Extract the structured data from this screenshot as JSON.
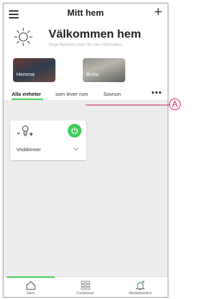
{
  "header": {
    "title": "Mitt hem",
    "welcome": "Välkommen hem",
    "subtitle": "Ange hemmets plats för mer information."
  },
  "modes": [
    {
      "label": "Hemma"
    },
    {
      "label": "Borta"
    }
  ],
  "tabs": [
    {
      "label": "Alla enheter"
    },
    {
      "label": "som lever rum"
    },
    {
      "label": "Sovrum"
    }
  ],
  "more_label": "•••",
  "device": {
    "name": "Vriddimmer",
    "bulb_minus": "–",
    "bulb_plus": "+"
  },
  "callout": {
    "label": "A"
  },
  "nav": [
    {
      "label": "Hem"
    },
    {
      "label": "Funktioner"
    },
    {
      "label": "Meddelanden"
    }
  ],
  "colors": {
    "accent": "#3dcd58",
    "callout": "#d71a5a",
    "background": "#ececec"
  }
}
